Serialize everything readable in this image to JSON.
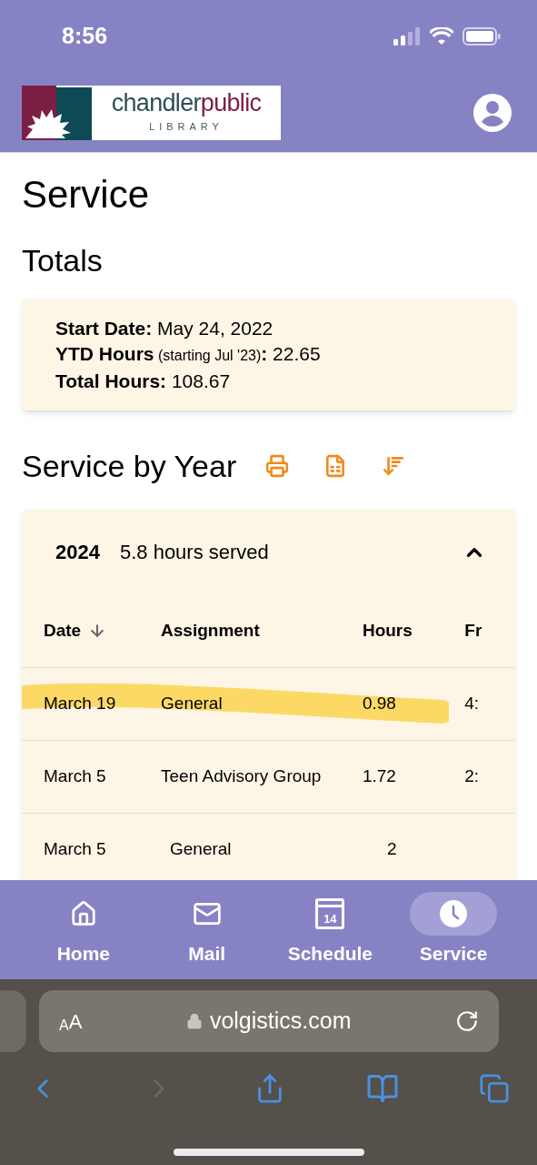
{
  "status_bar": {
    "time": "8:56"
  },
  "header": {
    "logo": {
      "word_1": "chandler",
      "word_2": "public",
      "subtitle": "LIBRARY"
    }
  },
  "page_title": "Service",
  "totals": {
    "title": "Totals",
    "lines": [
      {
        "label": "Start Date:",
        "value": "May 24, 2022"
      },
      {
        "label": "YTD Hours",
        "note": "(starting Jul '23)",
        "label_end": ":",
        "value": "22.65"
      },
      {
        "label": "Total Hours:",
        "value": "108.67"
      }
    ]
  },
  "service_by_year": {
    "title": "Service by Year",
    "tools": [
      {
        "kind": "print"
      },
      {
        "kind": "excel"
      },
      {
        "kind": "sort"
      }
    ],
    "year_panel": {
      "year": "2024",
      "summary": "5.8 hours served",
      "expanded": true,
      "table": {
        "columns": [
          {
            "label": "Date",
            "sorted": true
          },
          {
            "label": "Assignment",
            "sorted": false
          },
          {
            "label": "Hours",
            "sorted": false
          },
          {
            "label": "Fr",
            "sorted": false
          }
        ],
        "rows": [
          {
            "cells": [
              "March 19",
              "General",
              "0.98",
              "4:"
            ],
            "highlighted": true
          },
          {
            "cells": [
              "March 5",
              "Teen Advisory Group",
              "1.72",
              "2:"
            ],
            "highlighted": false
          },
          {
            "cells": [
              "March 5",
              "General",
              "2"
            ],
            "highlighted": false
          }
        ]
      }
    }
  },
  "bottom_nav": [
    {
      "kind": "home",
      "label": "Home",
      "selected": false
    },
    {
      "kind": "mail",
      "label": "Mail",
      "selected": false
    },
    {
      "kind": "calendar",
      "label": "Schedule",
      "day": "14",
      "selected": false
    },
    {
      "kind": "clock",
      "label": "Service",
      "selected": true
    }
  ],
  "browser": {
    "text_size": [
      "A",
      "A"
    ],
    "url": "volgistics.com",
    "back_enabled": true,
    "forward_enabled": false
  }
}
